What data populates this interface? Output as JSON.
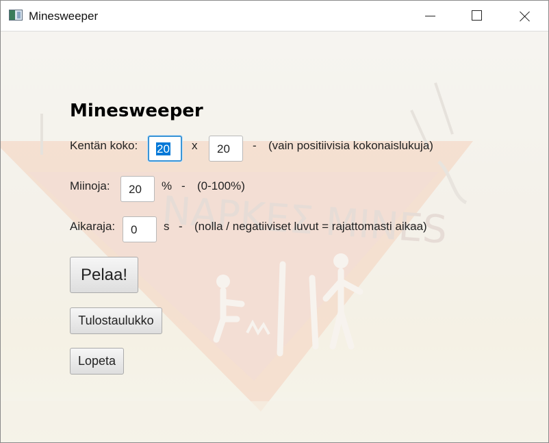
{
  "window": {
    "title": "Minesweeper"
  },
  "form": {
    "heading": "Minesweeper",
    "size": {
      "label": "Kentän koko:",
      "width": "20",
      "separator": "x",
      "height": "20",
      "dash": "-",
      "hint": "(vain positiivisia kokonaislukuja)"
    },
    "mines": {
      "label": "Miinoja:",
      "value": "20",
      "unit": "%",
      "dash": "-",
      "hint": "(0-100%)"
    },
    "timelimit": {
      "label": "Aikaraja:",
      "value": "0",
      "unit": "s",
      "dash": "-",
      "hint": "(nolla / negatiiviset luvut = rajattomasti aikaa)"
    }
  },
  "buttons": {
    "play": "Pelaa!",
    "scoreboard": "Tulostaulukko",
    "quit": "Lopeta"
  },
  "background_sign": {
    "text": "ΝΑΡΚΕΣ  MINES"
  },
  "colors": {
    "accent": "#0078d7",
    "focus_border": "#3a94d6"
  }
}
